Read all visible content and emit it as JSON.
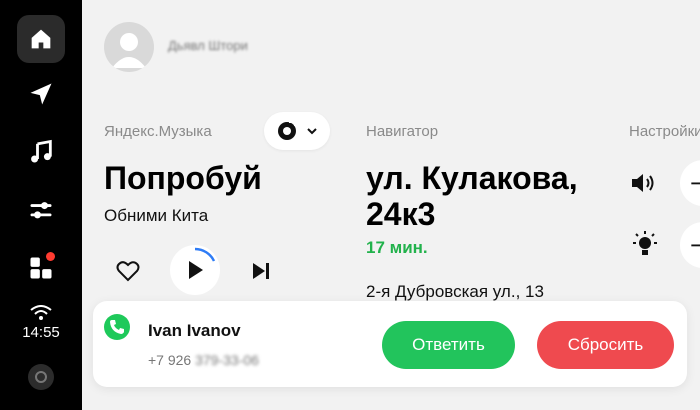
{
  "sidebar": {
    "items": [
      {
        "icon": "home-icon"
      },
      {
        "icon": "navigation-arrow-icon"
      },
      {
        "icon": "music-note-icon"
      },
      {
        "icon": "sliders-icon"
      },
      {
        "icon": "apps-grid-icon"
      }
    ],
    "time": "14:55"
  },
  "header": {
    "user_name": "Дьявл Штори"
  },
  "music": {
    "section_label": "Яндекс.Музыка",
    "track_title": "Попробуй",
    "artist": "Обними Кита"
  },
  "navigator": {
    "section_label": "Навигатор",
    "address": "ул. Кулакова, 24к3",
    "eta": "17 мин.",
    "from": "2-я Дубровская ул., 13"
  },
  "settings": {
    "section_label": "Настройки"
  },
  "call": {
    "caller_name": "Ivan Ivanov",
    "number_prefix": "+7 926",
    "number_hidden": "379-33-06",
    "accept_label": "Ответить",
    "decline_label": "Сбросить"
  },
  "colors": {
    "accent_green": "#22c45c",
    "decline_red": "#ef4a4f",
    "eta_green": "#22b24c",
    "badge_red": "#ff3b30"
  }
}
